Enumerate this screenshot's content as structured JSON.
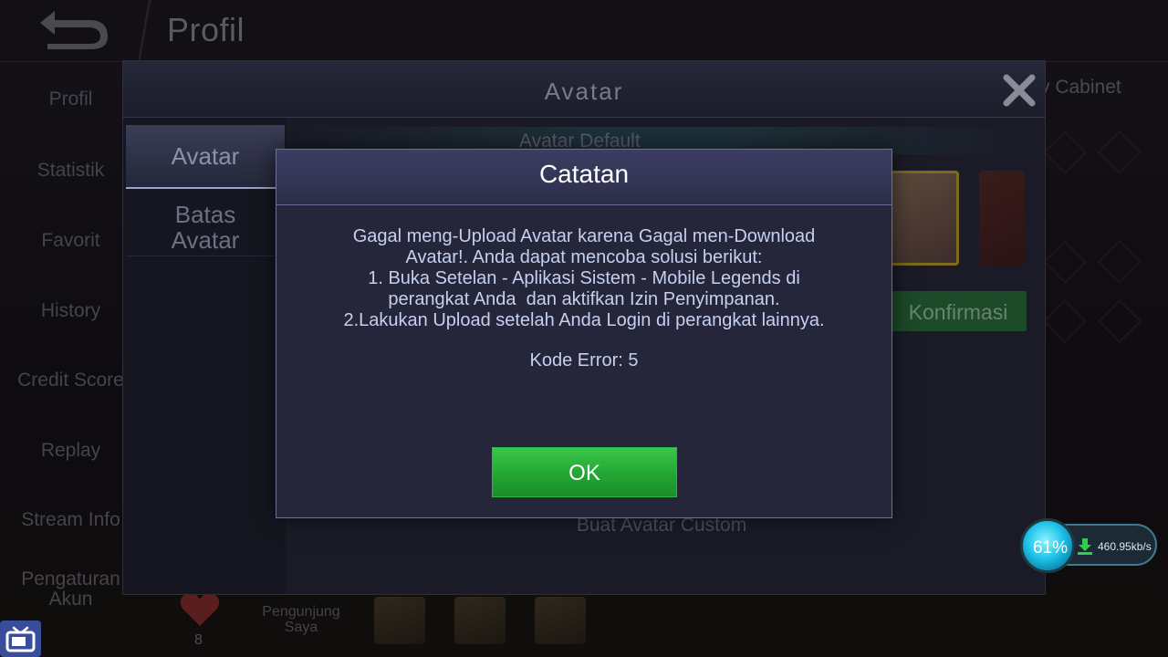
{
  "background": {
    "page_title": "Profil",
    "cabinet_label": "y Cabinet",
    "sidebar": {
      "items": [
        {
          "label": "Profil"
        },
        {
          "label": "Statistik"
        },
        {
          "label": "Favorit"
        },
        {
          "label": "History"
        },
        {
          "label": "Credit Score"
        },
        {
          "label": "Replay"
        },
        {
          "label": "Stream Info"
        },
        {
          "label": "Pengaturan\nAkun"
        }
      ]
    },
    "visitors": {
      "count": "8",
      "label": "Pengunjung\nSaya"
    }
  },
  "avatar_panel": {
    "title": "Avatar",
    "tabs": [
      {
        "label": "Avatar",
        "selected": true
      },
      {
        "label": "Batas\nAvatar",
        "selected": false
      }
    ],
    "section_label": "Avatar Default",
    "confirm_label": "Konfirmasi",
    "custom_label": "Buat Avatar Custom"
  },
  "modal": {
    "title": "Catatan",
    "message_lines": [
      "Gagal meng-Upload Avatar karena Gagal men-Download",
      "Avatar!. Anda dapat mencoba solusi berikut:",
      "1. Buka Setelan - Aplikasi Sistem - Mobile Legends di",
      "perangkat Anda  dan aktifkan Izin Penyimpanan.",
      "2.Lakukan Upload setelah Anda Login di perangkat lainnya."
    ],
    "error_code": "Kode Error: 5",
    "ok_label": "OK"
  },
  "speed_overlay": {
    "percent": "61%",
    "download_speed": "460.95kb/s"
  },
  "colors": {
    "ok_green": "#23a533",
    "modal_bg": "#25263a",
    "modal_text": "#c5d0ef",
    "speed_accent": "#1fc3e8"
  },
  "icons": {
    "back": "back-arrow-icon",
    "close": "close-icon",
    "download": "download-arrow-icon",
    "tv": "tv-icon",
    "heart": "heart-icon"
  }
}
